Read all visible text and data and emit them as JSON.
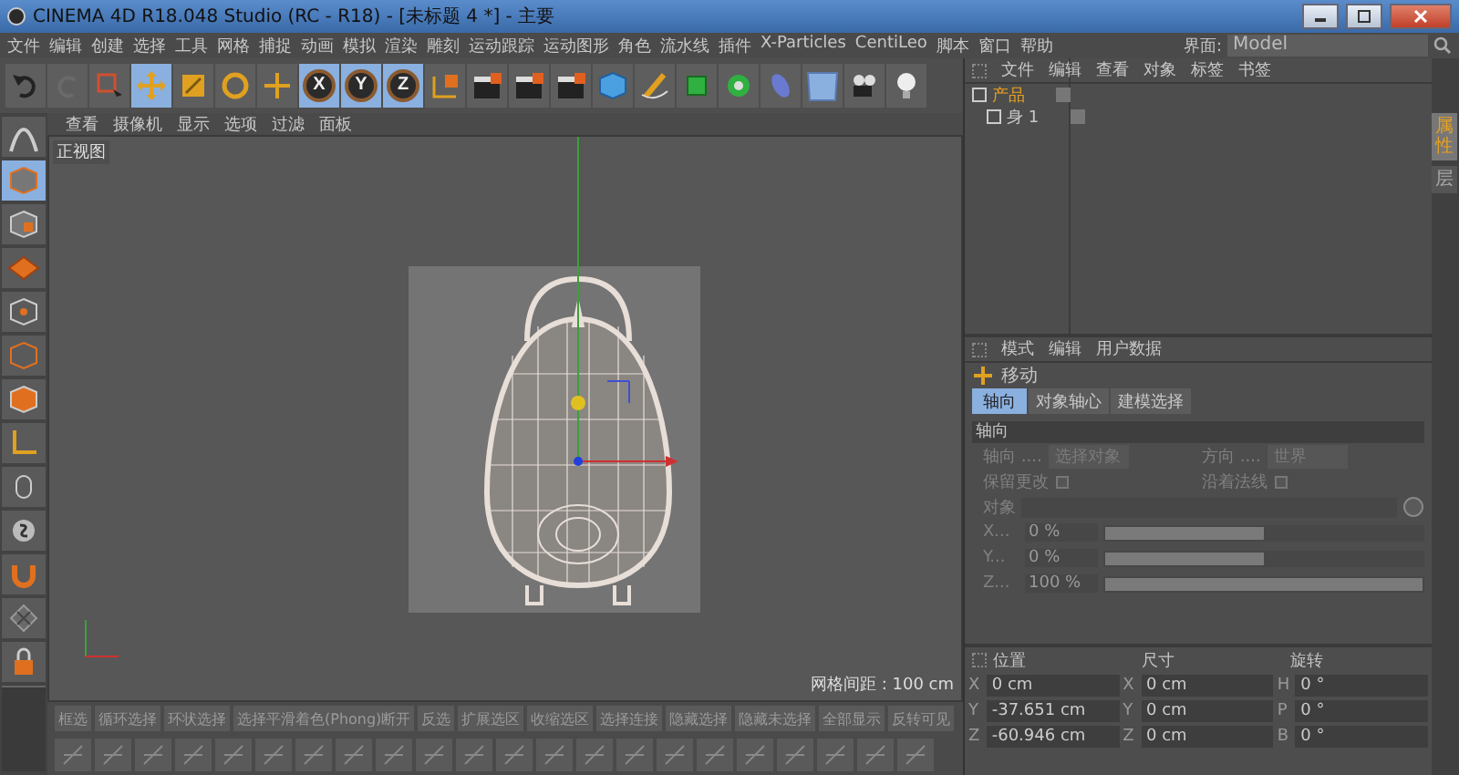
{
  "window": {
    "title": "CINEMA 4D R18.048 Studio (RC - R18) - [未标题 4 *] - 主要"
  },
  "menu": [
    "文件",
    "编辑",
    "创建",
    "选择",
    "工具",
    "网格",
    "捕捉",
    "动画",
    "模拟",
    "渲染",
    "雕刻",
    "运动跟踪",
    "运动图形",
    "角色",
    "流水线",
    "插件",
    "X-Particles",
    "CentiLeo",
    "脚本",
    "窗口",
    "帮助"
  ],
  "layout": {
    "label": "界面:",
    "value": "Model"
  },
  "toolbar": [
    {
      "kind": "undo",
      "selected": false
    },
    {
      "kind": "redo",
      "selected": false
    },
    {
      "kind": "select",
      "selected": false
    },
    {
      "kind": "move",
      "selected": true
    },
    {
      "kind": "scale",
      "selected": false
    },
    {
      "kind": "rotate",
      "selected": false
    },
    {
      "kind": "add",
      "selected": false
    },
    {
      "kind": "axis",
      "label": "X",
      "selected": true
    },
    {
      "kind": "axis",
      "label": "Y",
      "selected": true
    },
    {
      "kind": "axis",
      "label": "Z",
      "selected": true
    },
    {
      "kind": "coords",
      "selected": false
    },
    {
      "kind": "render",
      "selected": false
    },
    {
      "kind": "render",
      "selected": false
    },
    {
      "kind": "render",
      "selected": false
    },
    {
      "kind": "cube",
      "selected": false
    },
    {
      "kind": "pen",
      "selected": false
    },
    {
      "kind": "gear",
      "selected": false
    },
    {
      "kind": "flower",
      "selected": false
    },
    {
      "kind": "capsule",
      "selected": false
    },
    {
      "kind": "floor",
      "selected": false
    },
    {
      "kind": "camera",
      "selected": false
    },
    {
      "kind": "bulb",
      "selected": false
    }
  ],
  "mode_tools": [
    {
      "selected": false
    },
    {
      "selected": true
    },
    {
      "selected": false
    },
    {
      "selected": false
    },
    {
      "selected": false
    },
    {
      "selected": false
    },
    {
      "selected": false
    },
    {
      "selected": false
    },
    {
      "selected": false
    },
    {
      "selected": false
    },
    {
      "selected": false
    },
    {
      "selected": false
    },
    {
      "selected": false
    }
  ],
  "viewport": {
    "menu": [
      "查看",
      "摄像机",
      "显示",
      "选项",
      "过滤",
      "面板"
    ],
    "view_name": "正视图",
    "grid_spacing": "网格间距 : 100 cm"
  },
  "bottom_toolbar": [
    "框选",
    "循环选择",
    "环状选择",
    "选择平滑着色(Phong)断开",
    "反选",
    "扩展选区",
    "收缩选区",
    "选择连接",
    "隐藏选择",
    "隐藏未选择",
    "全部显示",
    "反转可见"
  ],
  "object_manager": {
    "menu": [
      "文件",
      "编辑",
      "查看",
      "对象",
      "标签",
      "书签"
    ],
    "objects": [
      {
        "name": "产品",
        "selected": true,
        "children": [
          {
            "name": "身 1",
            "selected": false
          }
        ]
      }
    ]
  },
  "attributes": {
    "menu": [
      "模式",
      "编辑",
      "用户数据"
    ],
    "tool": "移动",
    "tabs": [
      {
        "label": "轴向",
        "selected": true
      },
      {
        "label": "对象轴心",
        "selected": false
      },
      {
        "label": "建模选择",
        "selected": false
      }
    ],
    "section": "轴向",
    "dropdowns": [
      {
        "label": "轴向 ....",
        "value": "选择对象"
      },
      {
        "label": "方向 ....",
        "value": "世界"
      }
    ],
    "checks": [
      {
        "label": "保留更改",
        "checked": false
      },
      {
        "label": "沿着法线",
        "checked": false
      }
    ],
    "object_label": "对象",
    "sliders": [
      {
        "label": "X...",
        "value": "0 %",
        "level": 0.5
      },
      {
        "label": "Y...",
        "value": "0 %",
        "level": 0.5
      },
      {
        "label": "Z...",
        "value": "100 %",
        "level": 1
      }
    ]
  },
  "coordinates": {
    "headers": [
      "位置",
      "尺寸",
      "旋转"
    ],
    "rows": [
      [
        {
          "axis": "X",
          "value": "0 cm"
        },
        {
          "axis": "X",
          "value": "0 cm"
        },
        {
          "axis": "H",
          "value": "0 °"
        }
      ],
      [
        {
          "axis": "Y",
          "value": "-37.651 cm"
        },
        {
          "axis": "Y",
          "value": "0 cm"
        },
        {
          "axis": "P",
          "value": "0 °"
        }
      ],
      [
        {
          "axis": "Z",
          "value": "-60.946 cm"
        },
        {
          "axis": "Z",
          "value": "0 cm"
        },
        {
          "axis": "B",
          "value": "0 °"
        }
      ]
    ]
  },
  "side_tabs": [
    {
      "label": "属性",
      "selected": true
    },
    {
      "label": "层",
      "selected": false
    }
  ]
}
